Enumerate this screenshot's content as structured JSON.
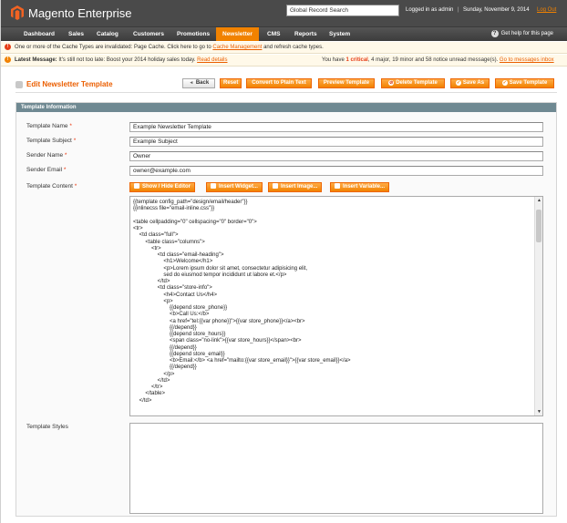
{
  "header": {
    "brand": "Magento Enterprise",
    "search_value": "Global Record Search",
    "login_text": "Logged in as admin",
    "separator": "|",
    "date_text": "Sunday, November 9, 2014",
    "logout_label": "Log Out"
  },
  "nav": {
    "items": [
      "Dashboard",
      "Sales",
      "Catalog",
      "Customers",
      "Promotions",
      "Newsletter",
      "CMS",
      "Reports",
      "System"
    ],
    "active": "Newsletter",
    "help_label": "Get help for this page"
  },
  "messages": {
    "cache_text_1": "One or more of the Cache Types are invalidated: Page Cache. Click here to go to ",
    "cache_link": "Cache Management",
    "cache_text_2": " and refresh cache types.",
    "latest_label": "Latest Message:",
    "latest_text": " It's still not too late: Boost your 2014 holiday sales today. ",
    "latest_link": "Read details",
    "count_prefix": "You have ",
    "critical_count": "1 critical",
    "count_rest": ", 4 major, 19 minor and 58 notice unread message(s). ",
    "messages_link": "Go to messages inbox"
  },
  "page": {
    "title": "Edit Newsletter Template",
    "buttons": {
      "back": "Back",
      "reset": "Reset",
      "convert": "Convert to Plain Text",
      "preview": "Preview Template",
      "delete": "Delete Template",
      "save_as": "Save As",
      "save": "Save Template"
    }
  },
  "form": {
    "section_title": "Template Information",
    "name_label": "Template Name",
    "name_value": "Example Newsletter Template",
    "subject_label": "Template Subject",
    "subject_value": "Example Subject",
    "sender_name_label": "Sender Name",
    "sender_name_value": "Owner",
    "sender_email_label": "Sender Email",
    "sender_email_value": "owner@example.com",
    "content_label": "Template Content",
    "required_mark": "*",
    "editor_buttons": {
      "toggle": "Show / Hide Editor",
      "widget": "Insert Widget...",
      "image": "Insert Image...",
      "variable": "Insert Variable..."
    },
    "content_lines": [
      "{{template config_path=\"design/email/header\"}}",
      "{{inlinecss file=\"email-inline.css\"}}",
      "",
      "<table cellpadding=\"0\" cellspacing=\"0\" border=\"0\">",
      "<tr>",
      "    <td class=\"full\">",
      "        <table class=\"columns\">",
      "            <tr>",
      "                <td class=\"email-heading\">",
      "                    <h1>Welcome</h1>",
      "                    <p>Lorem ipsum dolor sit amet, consectetur adipisicing elit,",
      "                    sed do eiusmod tempor incididunt ut labore et.</p>",
      "                </td>",
      "                <td class=\"store-info\">",
      "                    <h4>Contact Us</h4>",
      "                    <p>",
      "                        {{depend store_phone}}",
      "                        <b>Call Us:</b>",
      "                        <a href=\"tel:{{var phone}}\">{{var store_phone}}</a><br>",
      "                        {{/depend}}",
      "                        {{depend store_hours}}",
      "                        <span class=\"no-link\">{{var store_hours}}</span><br>",
      "                        {{/depend}}",
      "                        {{depend store_email}}",
      "                        <b>Email:</b> <a href=\"mailto:{{var store_email}}\">{{var store_email}}</a>",
      "                        {{/depend}}",
      "                    </p>",
      "                </td>",
      "            </tr>",
      "        </table>",
      "    </td>"
    ],
    "styles_label": "Template Styles",
    "styles_value": ""
  },
  "colors": {
    "accent": "#f18200",
    "header_bg": "#4a4a4a",
    "section_header": "#6f8992"
  },
  "icons": [
    "magento-logo-icon",
    "question-icon",
    "error-icon",
    "warning-icon",
    "back-arrow-icon",
    "page-icon"
  ]
}
